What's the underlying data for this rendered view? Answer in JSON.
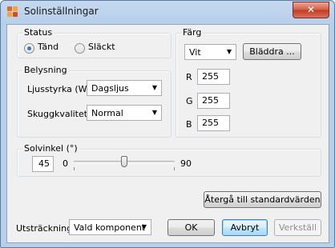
{
  "window": {
    "title": "Solinställningar",
    "close_glyph": "✕"
  },
  "status": {
    "legend": "Status",
    "options": [
      {
        "label": "Tänd",
        "selected": true
      },
      {
        "label": "Släckt",
        "selected": false
      }
    ]
  },
  "lighting": {
    "legend": "Belysning",
    "intensity_label": "Ljusstyrka (W)",
    "intensity_value": "Dagsljus",
    "shadow_label": "Skuggkvalitet",
    "shadow_value": "Normal"
  },
  "color": {
    "legend": "Färg",
    "selected": "Vit",
    "browse_label": "Bläddra ...",
    "r_label": "R",
    "r_value": "255",
    "g_label": "G",
    "g_value": "255",
    "b_label": "B",
    "b_value": "255"
  },
  "sun_angle": {
    "legend": "Solvinkel (°)",
    "value": "45",
    "min_label": "0",
    "max_label": "90",
    "slider_fraction": 0.5
  },
  "footer": {
    "reset_label": "Återgå till standardvärden",
    "extent_label": "Utsträckning",
    "extent_value": "Vald komponent",
    "ok_label": "OK",
    "cancel_label": "Avbryt",
    "apply_label": "Verkställ"
  },
  "icons": {
    "app": "app-logo-icon",
    "dropdown": "chevron-down-icon"
  },
  "colors": {
    "accent": "#3a76c8",
    "title_bg": "#b8cfea",
    "close": "#c23b22"
  }
}
